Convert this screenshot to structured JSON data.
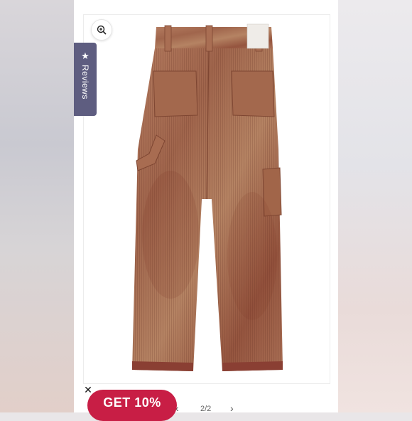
{
  "reviews_tab": {
    "label": "Reviews",
    "icon": "star-icon"
  },
  "zoom": {
    "icon": "zoom-in-icon"
  },
  "gallery": {
    "counter": "2/2",
    "prev_icon": "chevron-left-icon",
    "next_icon": "chevron-right-icon"
  },
  "popup": {
    "label": "GET 10%",
    "close_icon": "close-icon"
  },
  "colors": {
    "accent": "#c81e45",
    "reviews_tab": "#5e5d80",
    "product": "#a0654c"
  }
}
